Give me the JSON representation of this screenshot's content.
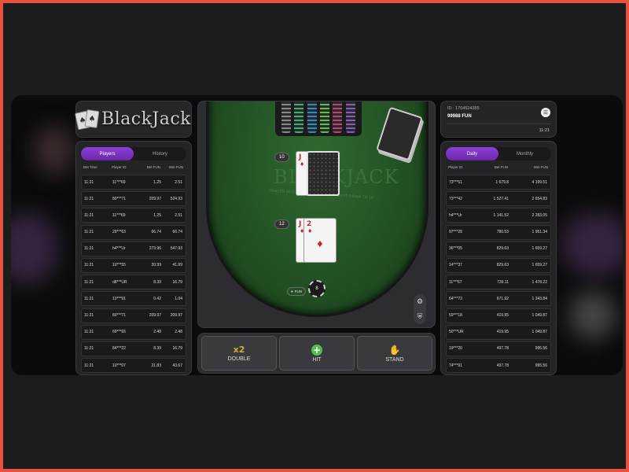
{
  "logo": {
    "text": "BlackJack"
  },
  "left": {
    "tabs": [
      "Players",
      "History"
    ],
    "headers": [
      "Bet Time",
      "Player ID",
      "Bet FUN",
      "Win FUN"
    ],
    "rows": [
      [
        "11:21",
        "11***69",
        "1.25",
        "2.51"
      ],
      [
        "11:21",
        "80***71",
        "209.97",
        "524.93"
      ],
      [
        "11:21",
        "11***69",
        "1.25",
        "2.51"
      ],
      [
        "11:21",
        "29***63",
        "66.74",
        "66.74"
      ],
      [
        "11:21",
        "h4***Ur",
        "273.96",
        "547.93"
      ],
      [
        "11:21",
        "10***55",
        "20.99",
        "41.99"
      ],
      [
        "11:21",
        "d8***UR",
        "8.39",
        "16.79"
      ],
      [
        "11:21",
        "10***91",
        "0.42",
        "1.04"
      ],
      [
        "11:21",
        "80***71",
        "209.97",
        "209.97"
      ],
      [
        "11:21",
        "69***65",
        "2.48",
        "2.48"
      ],
      [
        "11:21",
        "84***22",
        "8.39",
        "16.79"
      ],
      [
        "11:21",
        "10***07",
        "21.83",
        "43.67"
      ]
    ]
  },
  "right": {
    "id_text": "ID : 1704624385",
    "balance": "99988 FUN",
    "time": "11:21",
    "tabs": [
      "Daily",
      "Monthly"
    ],
    "headers": [
      "Player ID",
      "Bet FUN",
      "Win FUN"
    ],
    "rows": [
      [
        "73***51",
        "1 679.8",
        "4 199.51"
      ],
      [
        "73***42",
        "1 527.41",
        "2 654.83"
      ],
      [
        "h4***Ur",
        "1 141.52",
        "2 283.05"
      ],
      [
        "97***28",
        "780.53",
        "1 951.34"
      ],
      [
        "36***05",
        "829.63",
        "1 659.27"
      ],
      [
        "14***37",
        "829.63",
        "1 659.27"
      ],
      [
        "11***67",
        "739.11",
        "1 478.22"
      ],
      [
        "64***73",
        "671.92",
        "1 343.84"
      ],
      [
        "59***18",
        "419.95",
        "1 049.87"
      ],
      [
        "50***UR",
        "419.95",
        "1 049.87"
      ],
      [
        "19***20",
        "497.78",
        "995.56"
      ],
      [
        "74***91",
        "497.78",
        "995.56"
      ]
    ]
  },
  "table": {
    "felt_logo": "BLACKJACK",
    "felt_rule": "DEALER MUST STAND TO 17, AND MUST DRAW TO 16",
    "dealer_score": "10",
    "dealer_card_rank": "J",
    "dealer_card_suit": "♦",
    "player_score": "12",
    "player_cards": [
      {
        "rank": "J",
        "suit": "♦"
      },
      {
        "rank": "2",
        "suit": "♦"
      }
    ],
    "fun_label": "FUN",
    "bet_chip": "8"
  },
  "actions": {
    "double_icon": "x2",
    "double": "DOUBLE",
    "hit_icon": "+",
    "hit": "HIT",
    "stand_icon": "✋",
    "stand": "STAND"
  },
  "colors": {
    "accent": "#8c3fd6",
    "felt": "#2f6a30",
    "hit": "#4fc14f",
    "stand": "#e8533f",
    "double": "#d4a83a"
  }
}
